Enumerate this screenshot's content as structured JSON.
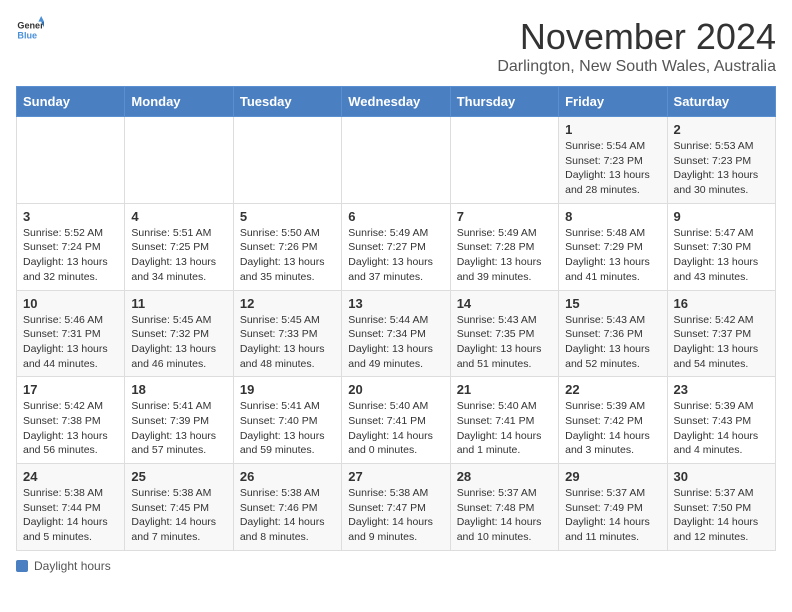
{
  "header": {
    "logo_general": "General",
    "logo_blue": "Blue",
    "month_title": "November 2024",
    "location": "Darlington, New South Wales, Australia"
  },
  "days_of_week": [
    "Sunday",
    "Monday",
    "Tuesday",
    "Wednesday",
    "Thursday",
    "Friday",
    "Saturday"
  ],
  "weeks": [
    [
      {
        "day": "",
        "info": ""
      },
      {
        "day": "",
        "info": ""
      },
      {
        "day": "",
        "info": ""
      },
      {
        "day": "",
        "info": ""
      },
      {
        "day": "",
        "info": ""
      },
      {
        "day": "1",
        "info": "Sunrise: 5:54 AM\nSunset: 7:23 PM\nDaylight: 13 hours and 28 minutes."
      },
      {
        "day": "2",
        "info": "Sunrise: 5:53 AM\nSunset: 7:23 PM\nDaylight: 13 hours and 30 minutes."
      }
    ],
    [
      {
        "day": "3",
        "info": "Sunrise: 5:52 AM\nSunset: 7:24 PM\nDaylight: 13 hours and 32 minutes."
      },
      {
        "day": "4",
        "info": "Sunrise: 5:51 AM\nSunset: 7:25 PM\nDaylight: 13 hours and 34 minutes."
      },
      {
        "day": "5",
        "info": "Sunrise: 5:50 AM\nSunset: 7:26 PM\nDaylight: 13 hours and 35 minutes."
      },
      {
        "day": "6",
        "info": "Sunrise: 5:49 AM\nSunset: 7:27 PM\nDaylight: 13 hours and 37 minutes."
      },
      {
        "day": "7",
        "info": "Sunrise: 5:49 AM\nSunset: 7:28 PM\nDaylight: 13 hours and 39 minutes."
      },
      {
        "day": "8",
        "info": "Sunrise: 5:48 AM\nSunset: 7:29 PM\nDaylight: 13 hours and 41 minutes."
      },
      {
        "day": "9",
        "info": "Sunrise: 5:47 AM\nSunset: 7:30 PM\nDaylight: 13 hours and 43 minutes."
      }
    ],
    [
      {
        "day": "10",
        "info": "Sunrise: 5:46 AM\nSunset: 7:31 PM\nDaylight: 13 hours and 44 minutes."
      },
      {
        "day": "11",
        "info": "Sunrise: 5:45 AM\nSunset: 7:32 PM\nDaylight: 13 hours and 46 minutes."
      },
      {
        "day": "12",
        "info": "Sunrise: 5:45 AM\nSunset: 7:33 PM\nDaylight: 13 hours and 48 minutes."
      },
      {
        "day": "13",
        "info": "Sunrise: 5:44 AM\nSunset: 7:34 PM\nDaylight: 13 hours and 49 minutes."
      },
      {
        "day": "14",
        "info": "Sunrise: 5:43 AM\nSunset: 7:35 PM\nDaylight: 13 hours and 51 minutes."
      },
      {
        "day": "15",
        "info": "Sunrise: 5:43 AM\nSunset: 7:36 PM\nDaylight: 13 hours and 52 minutes."
      },
      {
        "day": "16",
        "info": "Sunrise: 5:42 AM\nSunset: 7:37 PM\nDaylight: 13 hours and 54 minutes."
      }
    ],
    [
      {
        "day": "17",
        "info": "Sunrise: 5:42 AM\nSunset: 7:38 PM\nDaylight: 13 hours and 56 minutes."
      },
      {
        "day": "18",
        "info": "Sunrise: 5:41 AM\nSunset: 7:39 PM\nDaylight: 13 hours and 57 minutes."
      },
      {
        "day": "19",
        "info": "Sunrise: 5:41 AM\nSunset: 7:40 PM\nDaylight: 13 hours and 59 minutes."
      },
      {
        "day": "20",
        "info": "Sunrise: 5:40 AM\nSunset: 7:41 PM\nDaylight: 14 hours and 0 minutes."
      },
      {
        "day": "21",
        "info": "Sunrise: 5:40 AM\nSunset: 7:41 PM\nDaylight: 14 hours and 1 minute."
      },
      {
        "day": "22",
        "info": "Sunrise: 5:39 AM\nSunset: 7:42 PM\nDaylight: 14 hours and 3 minutes."
      },
      {
        "day": "23",
        "info": "Sunrise: 5:39 AM\nSunset: 7:43 PM\nDaylight: 14 hours and 4 minutes."
      }
    ],
    [
      {
        "day": "24",
        "info": "Sunrise: 5:38 AM\nSunset: 7:44 PM\nDaylight: 14 hours and 5 minutes."
      },
      {
        "day": "25",
        "info": "Sunrise: 5:38 AM\nSunset: 7:45 PM\nDaylight: 14 hours and 7 minutes."
      },
      {
        "day": "26",
        "info": "Sunrise: 5:38 AM\nSunset: 7:46 PM\nDaylight: 14 hours and 8 minutes."
      },
      {
        "day": "27",
        "info": "Sunrise: 5:38 AM\nSunset: 7:47 PM\nDaylight: 14 hours and 9 minutes."
      },
      {
        "day": "28",
        "info": "Sunrise: 5:37 AM\nSunset: 7:48 PM\nDaylight: 14 hours and 10 minutes."
      },
      {
        "day": "29",
        "info": "Sunrise: 5:37 AM\nSunset: 7:49 PM\nDaylight: 14 hours and 11 minutes."
      },
      {
        "day": "30",
        "info": "Sunrise: 5:37 AM\nSunset: 7:50 PM\nDaylight: 14 hours and 12 minutes."
      }
    ]
  ],
  "footer": {
    "note": "Daylight hours"
  }
}
